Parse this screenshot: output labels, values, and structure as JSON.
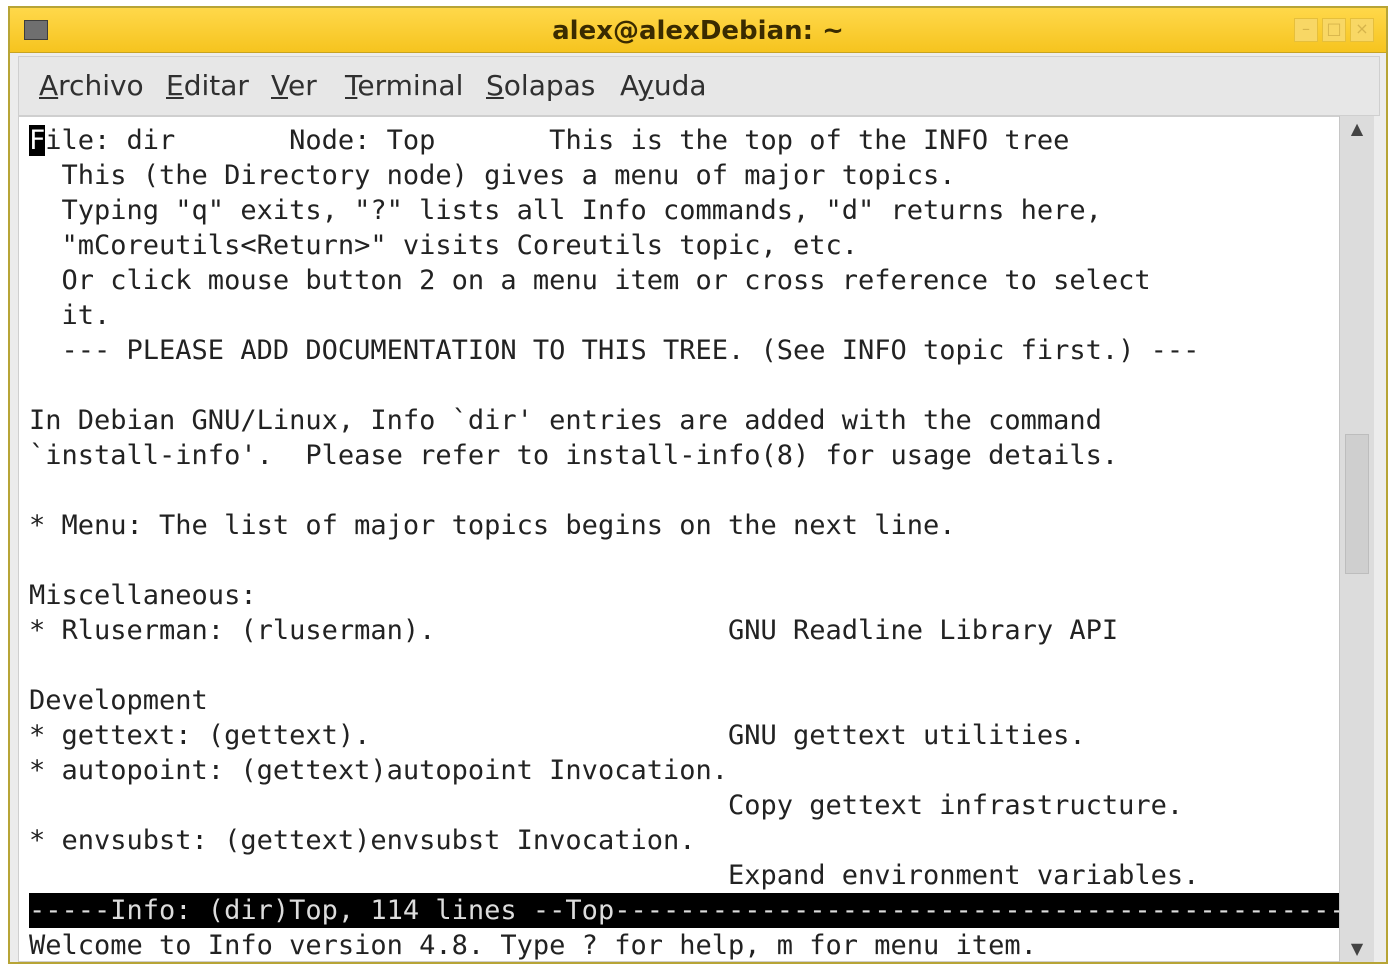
{
  "window": {
    "title": "alex@alexDebian: ~"
  },
  "menubar": {
    "items": [
      {
        "label": "Archivo",
        "mnemonic": "A"
      },
      {
        "label": "Editar",
        "mnemonic": "E"
      },
      {
        "label": "Ver",
        "mnemonic": "V"
      },
      {
        "label": "Terminal",
        "mnemonic": "T"
      },
      {
        "label": "Solapas",
        "mnemonic": "S"
      },
      {
        "label": "Ayuda",
        "mnemonic": "y"
      }
    ]
  },
  "terminal": {
    "cursor_char": "F",
    "lines": [
      "ile: dir       Node: Top       This is the top of the INFO tree",
      "  This (the Directory node) gives a menu of major topics.",
      "  Typing \"q\" exits, \"?\" lists all Info commands, \"d\" returns here,",
      "  \"mCoreutils<Return>\" visits Coreutils topic, etc.",
      "  Or click mouse button 2 on a menu item or cross reference to select",
      "  it.",
      "  --- PLEASE ADD DOCUMENTATION TO THIS TREE. (See INFO topic first.) ---",
      "",
      "In Debian GNU/Linux, Info `dir' entries are added with the command",
      "`install-info'.  Please refer to install-info(8) for usage details.",
      "",
      "* Menu: The list of major topics begins on the next line.",
      "",
      "Miscellaneous:",
      "* Rluserman: (rluserman).                  GNU Readline Library API",
      "",
      "Development",
      "* gettext: (gettext).                      GNU gettext utilities.",
      "* autopoint: (gettext)autopoint Invocation.",
      "                                           Copy gettext infrastructure.",
      "* envsubst: (gettext)envsubst Invocation.",
      "                                           Expand environment variables."
    ],
    "status_line": "-----Info: (dir)Top, 114 lines --Top-------------------------------------------------------",
    "echo_line": "Welcome to Info version 4.8. Type ? for help, m for menu item."
  }
}
